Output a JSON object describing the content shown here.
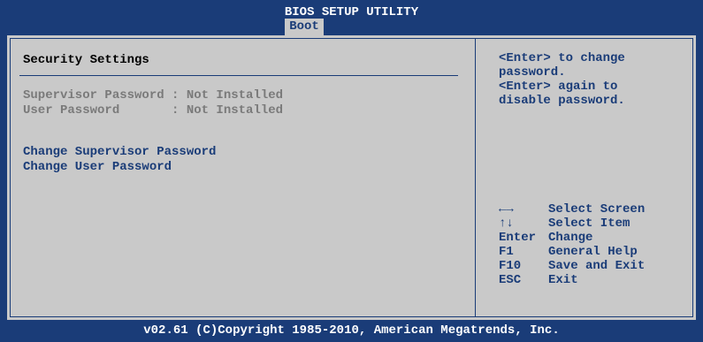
{
  "header": {
    "utility_title": "BIOS SETUP UTILITY",
    "active_tab": "Boot"
  },
  "main": {
    "section_title": "Security Settings",
    "status": [
      {
        "label": "Supervisor Password : Not Installed"
      },
      {
        "label": "User Password       : Not Installed"
      }
    ],
    "menu_items": [
      {
        "label": "Change Supervisor Password"
      },
      {
        "label": "Change User Password"
      }
    ]
  },
  "help": {
    "lines": [
      "<Enter> to change",
      "password.",
      "<Enter> again to",
      "disable password."
    ]
  },
  "keys": [
    {
      "key": "←→",
      "action": "Select Screen"
    },
    {
      "key": "↑↓",
      "action": "Select Item"
    },
    {
      "key": "Enter",
      "action": "Change"
    },
    {
      "key": "F1",
      "action": "General Help"
    },
    {
      "key": "F10",
      "action": "Save and Exit"
    },
    {
      "key": "ESC",
      "action": "Exit"
    }
  ],
  "footer": {
    "copyright": "v02.61 (C)Copyright 1985-2010, American Megatrends, Inc."
  },
  "colors": {
    "background": "#1a3c78",
    "panel": "#c9c9c9",
    "menu_text": "#1a3c78",
    "disabled_text": "#7a7a7a"
  }
}
